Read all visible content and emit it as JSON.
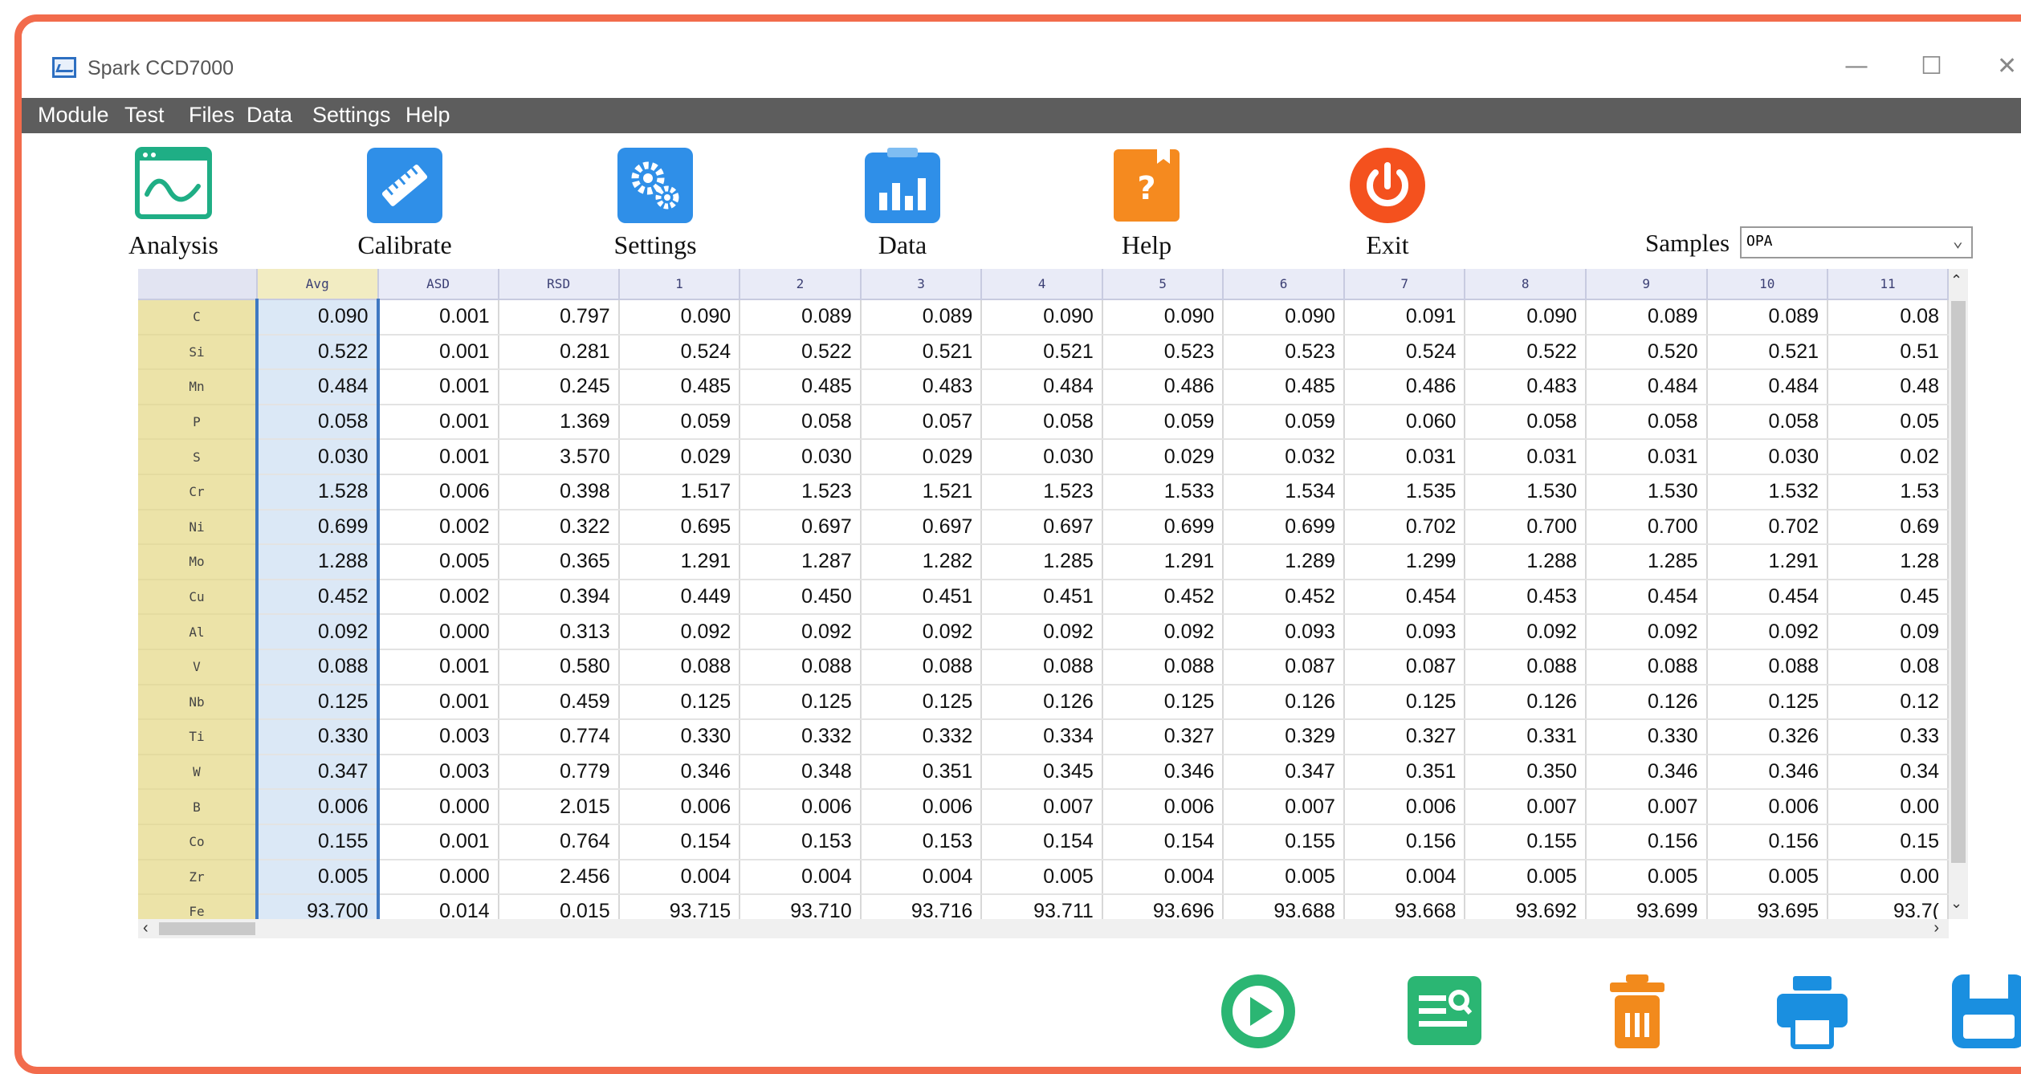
{
  "window": {
    "title": "Spark CCD7000",
    "controls": [
      "minimize-icon",
      "maximize-icon",
      "close-icon"
    ]
  },
  "menu": [
    "Module",
    "Test",
    "Files",
    "Data",
    "Settings",
    "Help"
  ],
  "toolbar": [
    {
      "label": "Analysis",
      "icon": "analysis-icon"
    },
    {
      "label": "Calibrate",
      "icon": "calibrate-icon"
    },
    {
      "label": "Settings",
      "icon": "settings-icon"
    },
    {
      "label": "Data",
      "icon": "data-icon"
    },
    {
      "label": "Help",
      "icon": "help-icon"
    },
    {
      "label": "Exit",
      "icon": "power-icon"
    }
  ],
  "samples": {
    "label": "Samples",
    "value": "OPA"
  },
  "table": {
    "columns": [
      "Avg",
      "ASD",
      "RSD",
      "1",
      "2",
      "3",
      "4",
      "5",
      "6",
      "7",
      "8",
      "9",
      "10",
      "11"
    ],
    "rows": [
      {
        "element": "C",
        "values": [
          "0.090",
          "0.001",
          "0.797",
          "0.090",
          "0.089",
          "0.089",
          "0.090",
          "0.090",
          "0.090",
          "0.091",
          "0.090",
          "0.089",
          "0.089",
          "0.08"
        ]
      },
      {
        "element": "Si",
        "values": [
          "0.522",
          "0.001",
          "0.281",
          "0.524",
          "0.522",
          "0.521",
          "0.521",
          "0.523",
          "0.523",
          "0.524",
          "0.522",
          "0.520",
          "0.521",
          "0.51"
        ]
      },
      {
        "element": "Mn",
        "values": [
          "0.484",
          "0.001",
          "0.245",
          "0.485",
          "0.485",
          "0.483",
          "0.484",
          "0.486",
          "0.485",
          "0.486",
          "0.483",
          "0.484",
          "0.484",
          "0.48"
        ]
      },
      {
        "element": "P",
        "values": [
          "0.058",
          "0.001",
          "1.369",
          "0.059",
          "0.058",
          "0.057",
          "0.058",
          "0.059",
          "0.059",
          "0.060",
          "0.058",
          "0.058",
          "0.058",
          "0.05"
        ]
      },
      {
        "element": "S",
        "values": [
          "0.030",
          "0.001",
          "3.570",
          "0.029",
          "0.030",
          "0.029",
          "0.030",
          "0.029",
          "0.032",
          "0.031",
          "0.031",
          "0.031",
          "0.030",
          "0.02"
        ]
      },
      {
        "element": "Cr",
        "values": [
          "1.528",
          "0.006",
          "0.398",
          "1.517",
          "1.523",
          "1.521",
          "1.523",
          "1.533",
          "1.534",
          "1.535",
          "1.530",
          "1.530",
          "1.532",
          "1.53"
        ]
      },
      {
        "element": "Ni",
        "values": [
          "0.699",
          "0.002",
          "0.322",
          "0.695",
          "0.697",
          "0.697",
          "0.697",
          "0.699",
          "0.699",
          "0.702",
          "0.700",
          "0.700",
          "0.702",
          "0.69"
        ]
      },
      {
        "element": "Mo",
        "values": [
          "1.288",
          "0.005",
          "0.365",
          "1.291",
          "1.287",
          "1.282",
          "1.285",
          "1.291",
          "1.289",
          "1.299",
          "1.288",
          "1.285",
          "1.291",
          "1.28"
        ]
      },
      {
        "element": "Cu",
        "values": [
          "0.452",
          "0.002",
          "0.394",
          "0.449",
          "0.450",
          "0.451",
          "0.451",
          "0.452",
          "0.452",
          "0.454",
          "0.453",
          "0.454",
          "0.454",
          "0.45"
        ]
      },
      {
        "element": "Al",
        "values": [
          "0.092",
          "0.000",
          "0.313",
          "0.092",
          "0.092",
          "0.092",
          "0.092",
          "0.092",
          "0.093",
          "0.093",
          "0.092",
          "0.092",
          "0.092",
          "0.09"
        ]
      },
      {
        "element": "V",
        "values": [
          "0.088",
          "0.001",
          "0.580",
          "0.088",
          "0.088",
          "0.088",
          "0.088",
          "0.088",
          "0.087",
          "0.087",
          "0.088",
          "0.088",
          "0.088",
          "0.08"
        ]
      },
      {
        "element": "Nb",
        "values": [
          "0.125",
          "0.001",
          "0.459",
          "0.125",
          "0.125",
          "0.125",
          "0.126",
          "0.125",
          "0.126",
          "0.125",
          "0.126",
          "0.126",
          "0.125",
          "0.12"
        ]
      },
      {
        "element": "Ti",
        "values": [
          "0.330",
          "0.003",
          "0.774",
          "0.330",
          "0.332",
          "0.332",
          "0.334",
          "0.327",
          "0.329",
          "0.327",
          "0.331",
          "0.330",
          "0.326",
          "0.33"
        ]
      },
      {
        "element": "W",
        "values": [
          "0.347",
          "0.003",
          "0.779",
          "0.346",
          "0.348",
          "0.351",
          "0.345",
          "0.346",
          "0.347",
          "0.351",
          "0.350",
          "0.346",
          "0.346",
          "0.34"
        ]
      },
      {
        "element": "B",
        "values": [
          "0.006",
          "0.000",
          "2.015",
          "0.006",
          "0.006",
          "0.006",
          "0.007",
          "0.006",
          "0.007",
          "0.006",
          "0.007",
          "0.007",
          "0.006",
          "0.00"
        ]
      },
      {
        "element": "Co",
        "values": [
          "0.155",
          "0.001",
          "0.764",
          "0.154",
          "0.153",
          "0.153",
          "0.154",
          "0.154",
          "0.155",
          "0.156",
          "0.155",
          "0.156",
          "0.156",
          "0.15"
        ]
      },
      {
        "element": "Zr",
        "values": [
          "0.005",
          "0.000",
          "2.456",
          "0.004",
          "0.004",
          "0.004",
          "0.005",
          "0.004",
          "0.005",
          "0.004",
          "0.005",
          "0.005",
          "0.005",
          "0.00"
        ]
      },
      {
        "element": "Fe",
        "values": [
          "93.700",
          "0.014",
          "0.015",
          "93.715",
          "93.710",
          "93.716",
          "93.711",
          "93.696",
          "93.688",
          "93.668",
          "93.692",
          "93.699",
          "93.695",
          "93.7("
        ]
      }
    ]
  },
  "bottom_actions": [
    {
      "icon": "play-icon",
      "color": "#2bb673"
    },
    {
      "icon": "search-report-icon",
      "color": "#2bb673"
    },
    {
      "icon": "trash-icon",
      "color": "#f28a1c"
    },
    {
      "icon": "print-icon",
      "color": "#1a8fe0"
    },
    {
      "icon": "save-icon",
      "color": "#1a8fe0"
    }
  ],
  "colors": {
    "frame": "#f26b4c",
    "menubar": "#5d5d5d",
    "avg_column": "#dbe8f6",
    "row_header": "#ece3a8"
  }
}
